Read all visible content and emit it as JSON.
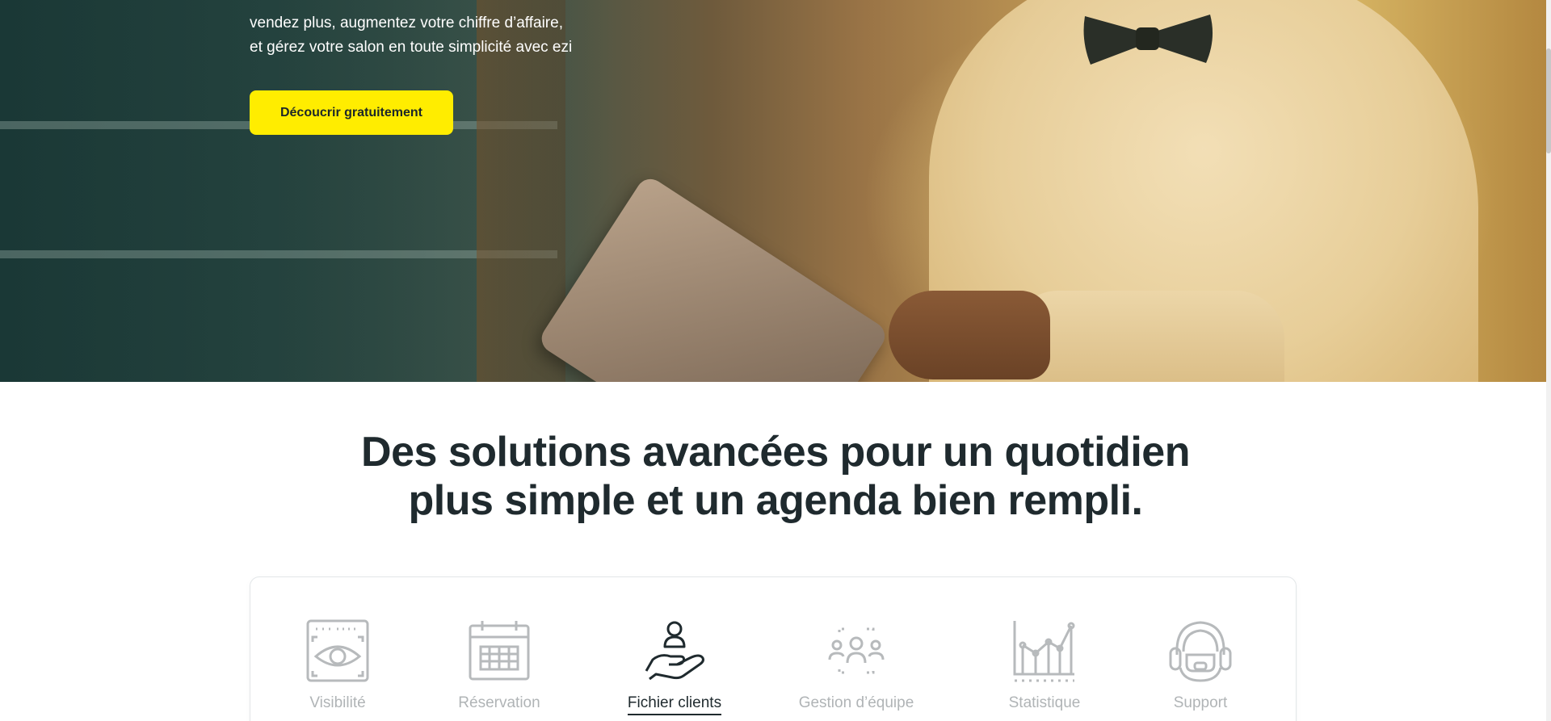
{
  "hero": {
    "line_1": "vendez plus, augmentez votre chiffre d’affaire,",
    "line_2": "et gérez votre salon en toute simplicité avec ezi",
    "cta_label": "Découcrir gratuitement"
  },
  "section": {
    "title_line_1": "Des solutions avancées pour un quotidien",
    "title_line_2": "plus simple et un agenda bien rempli."
  },
  "features": [
    {
      "label": "Visibilité",
      "icon": "eye-window-icon",
      "active": false
    },
    {
      "label": "Réservation",
      "icon": "calendar-icon",
      "active": false
    },
    {
      "label": "Fichier clients",
      "icon": "client-hand-icon",
      "active": true
    },
    {
      "label": "Gestion d’équipe",
      "icon": "team-icon",
      "active": false
    },
    {
      "label": "Statistique",
      "icon": "chart-icon",
      "active": false
    },
    {
      "label": "Support",
      "icon": "headset-icon",
      "active": false
    }
  ],
  "colors": {
    "accent": "#ffed00",
    "text_dark": "#1f2a2e",
    "inactive_gray": "#b0b4b6"
  }
}
